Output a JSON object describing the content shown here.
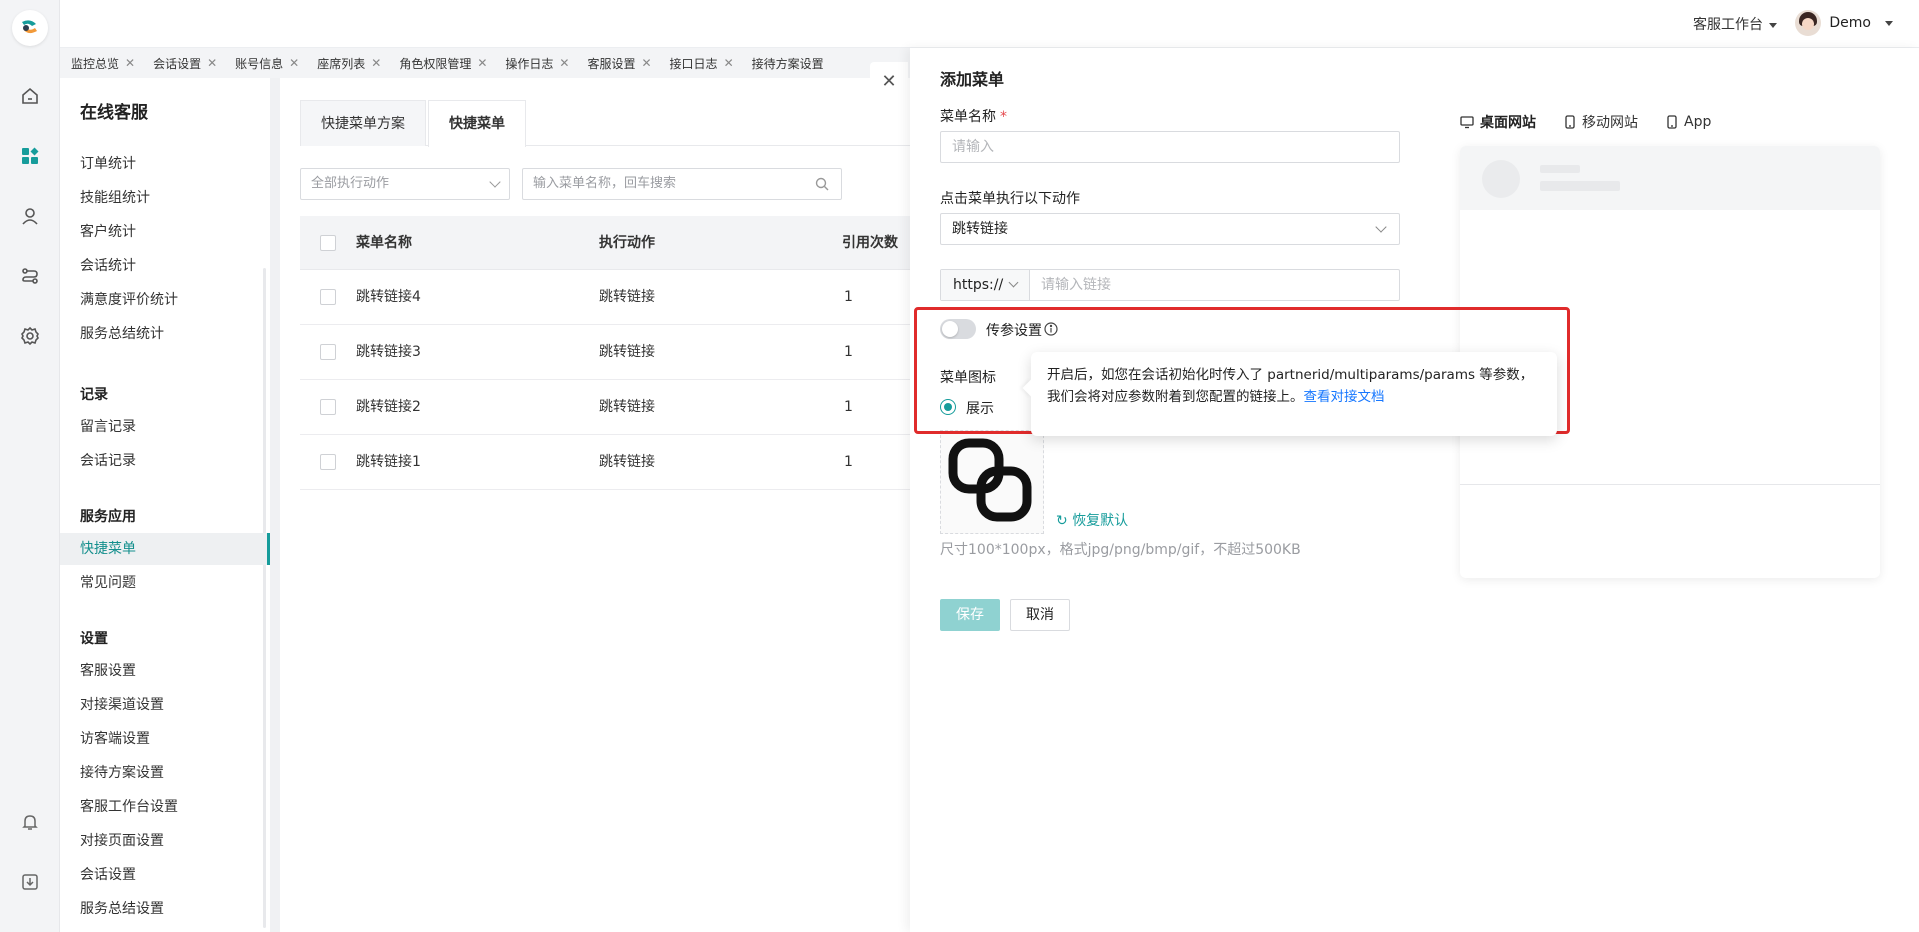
{
  "topbar": {
    "workspace": "客服工作台",
    "user": "Demo"
  },
  "tabs": [
    {
      "label": "监控总览"
    },
    {
      "label": "会话设置"
    },
    {
      "label": "账号信息"
    },
    {
      "label": "座席列表"
    },
    {
      "label": "角色权限管理"
    },
    {
      "label": "操作日志"
    },
    {
      "label": "客服设置"
    },
    {
      "label": "接口日志"
    },
    {
      "label": "接待方案设置"
    }
  ],
  "sidebar": {
    "title": "在线客服",
    "stats_items": [
      "订单统计",
      "技能组统计",
      "客户统计",
      "会话统计",
      "满意度评价统计",
      "服务总结统计"
    ],
    "group_records": "记录",
    "records_items": [
      "留言记录",
      "会话记录"
    ],
    "group_apps": "服务应用",
    "apps_items": [
      "快捷菜单",
      "常见问题"
    ],
    "group_settings": "设置",
    "settings_items": [
      "客服设置",
      "对接渠道设置",
      "访客端设置",
      "接待方案设置",
      "客服工作台设置",
      "对接页面设置",
      "会话设置",
      "服务总结设置"
    ]
  },
  "main": {
    "subtabs": [
      "快捷菜单方案",
      "快捷菜单"
    ],
    "filter_placeholder": "全部执行动作",
    "search_placeholder": "输入菜单名称，回车搜索",
    "columns": [
      "菜单名称",
      "执行动作",
      "引用次数"
    ],
    "rows": [
      {
        "name": "跳转链接4",
        "action": "跳转链接",
        "count": "1"
      },
      {
        "name": "跳转链接3",
        "action": "跳转链接",
        "count": "1"
      },
      {
        "name": "跳转链接2",
        "action": "跳转链接",
        "count": "1"
      },
      {
        "name": "跳转链接1",
        "action": "跳转链接",
        "count": "1"
      }
    ]
  },
  "drawer": {
    "title": "添加菜单",
    "name_label": "菜单名称",
    "required_mark": "*",
    "name_placeholder": "请输入",
    "action_label": "点击菜单执行以下动作",
    "action_value": "跳转链接",
    "url_prefix": "https://",
    "url_placeholder": "请输入链接",
    "param_label": "传参设置",
    "icon_label": "菜单图标",
    "radio_show": "展示",
    "restore_label": "恢复默认",
    "hint": "尺寸100*100px，格式jpg/png/bmp/gif，不超过500KB",
    "save": "保存",
    "cancel": "取消",
    "preview_tabs": [
      "桌面网站",
      "移动网站",
      "App"
    ],
    "popover_line1": "开启后，如您在会话初始化时传入了 partnerid/multiparams/params 等参数，",
    "popover_line2": "我们会将对应参数附着到您配置的链接上。",
    "popover_link": "查看对接文档"
  },
  "colors": {
    "accent": "#169c9b",
    "highlight": "#e02b2b",
    "link": "#1677ff"
  }
}
